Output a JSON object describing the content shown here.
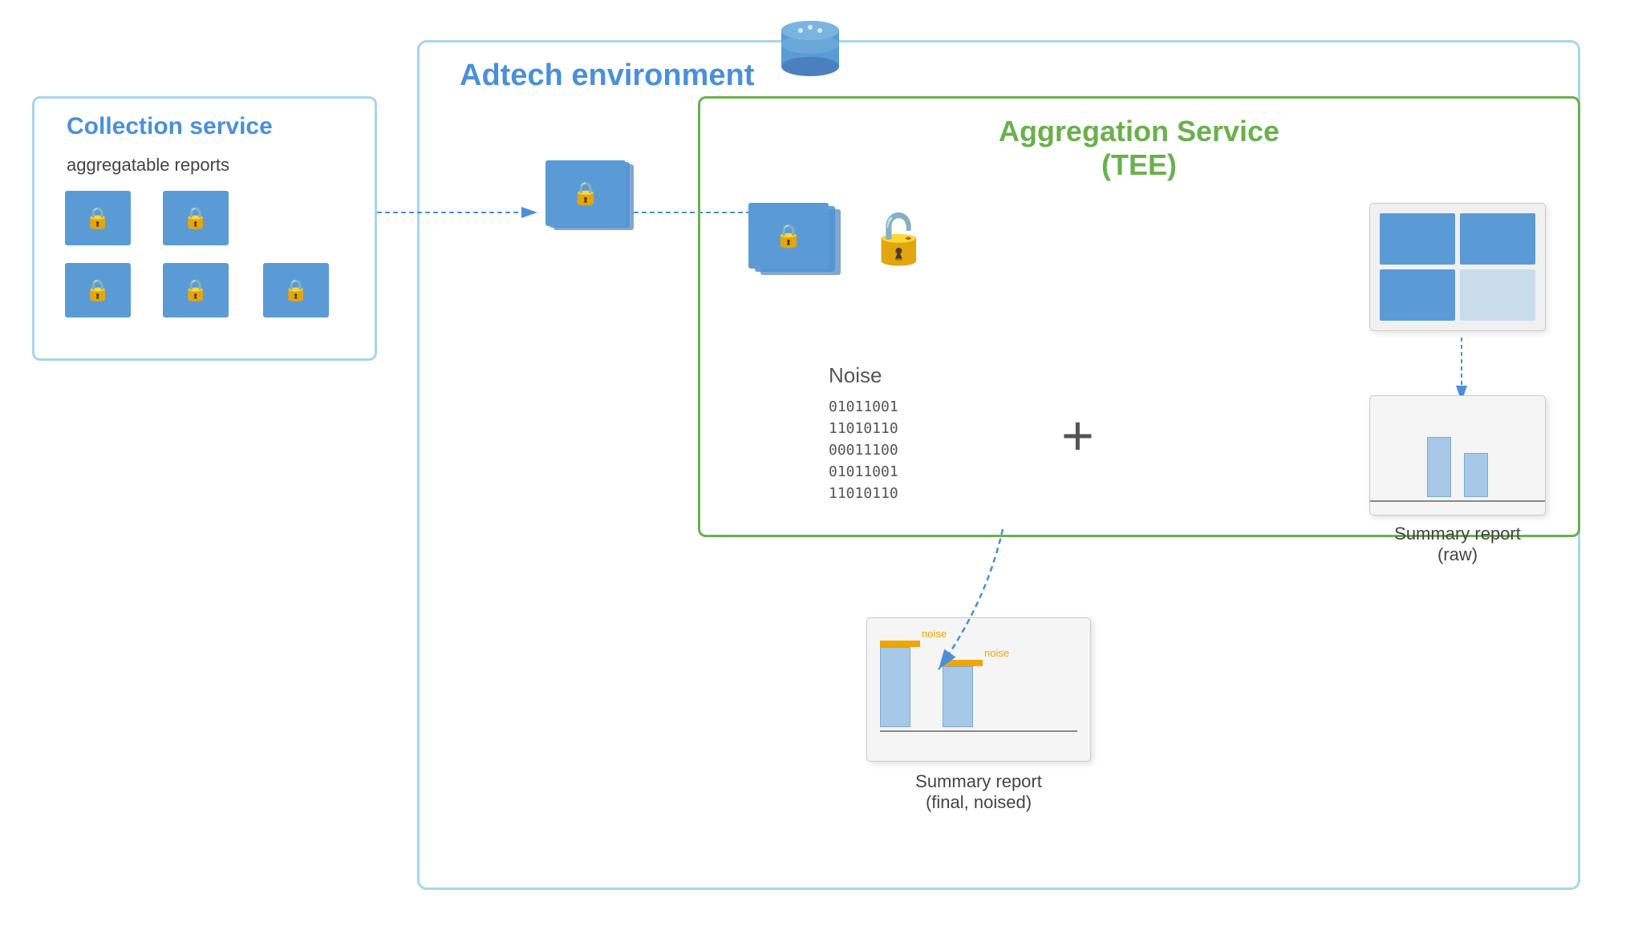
{
  "adtech": {
    "label": "Adtech environment"
  },
  "collection_service": {
    "title": "Collection service",
    "subtitle": "aggregatable reports"
  },
  "aggregation_service": {
    "title": "Aggregation Service",
    "subtitle": "(TEE)"
  },
  "noise": {
    "label": "Noise",
    "binary_lines": [
      "01011001",
      "11010110",
      "00011100",
      "01011001",
      "11010110"
    ]
  },
  "summary_raw": {
    "label": "Summary report",
    "sublabel": "(raw)"
  },
  "summary_final": {
    "label": "Summary report",
    "sublabel": "(final, noised)"
  },
  "noise_labels": {
    "label1": "noise",
    "label2": "noise"
  },
  "colors": {
    "blue": "#4a90d9",
    "green": "#6ab04c",
    "light_blue_border": "#a8d4f0",
    "lock_gold": "#f0a500",
    "doc_blue": "#5b9bd5"
  }
}
